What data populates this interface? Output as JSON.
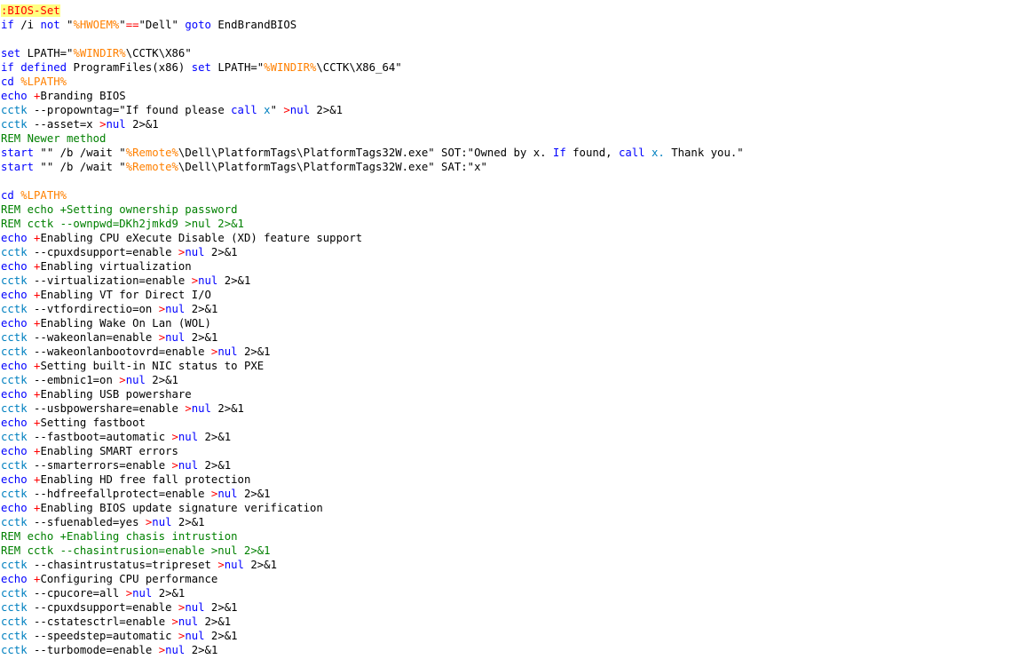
{
  "editor": {
    "language": "batch",
    "colors": {
      "keyword": "#0000ff",
      "string": "#808080",
      "variable": "#ff8000",
      "operator": "#ff0000",
      "label": "#ff0000",
      "label_highlight": "#ffff80",
      "comment": "#008000",
      "command": "#0080c0",
      "text": "#000000"
    },
    "lines": [
      [
        {
          "t": "label",
          "v": ":BIOS-Set"
        }
      ],
      [
        {
          "t": "kw",
          "v": "if"
        },
        {
          "t": "txt",
          "v": " /i "
        },
        {
          "t": "kw",
          "v": "not"
        },
        {
          "t": "txt",
          "v": " \""
        },
        {
          "t": "var",
          "v": "%HWOEM%"
        },
        {
          "t": "txt",
          "v": "\""
        },
        {
          "t": "op",
          "v": "=="
        },
        {
          "t": "txt",
          "v": "\"Dell\" "
        },
        {
          "t": "kw",
          "v": "goto"
        },
        {
          "t": "txt",
          "v": " EndBrandBIOS"
        }
      ],
      [],
      [
        {
          "t": "kw",
          "v": "set"
        },
        {
          "t": "txt",
          "v": " LPATH=\""
        },
        {
          "t": "var",
          "v": "%WINDIR%"
        },
        {
          "t": "txt",
          "v": "\\CCTK\\X86\""
        }
      ],
      [
        {
          "t": "kw",
          "v": "if defined"
        },
        {
          "t": "txt",
          "v": " ProgramFiles(x86) "
        },
        {
          "t": "kw",
          "v": "set"
        },
        {
          "t": "txt",
          "v": " LPATH=\""
        },
        {
          "t": "var",
          "v": "%WINDIR%"
        },
        {
          "t": "txt",
          "v": "\\CCTK\\X86_64\""
        }
      ],
      [
        {
          "t": "kw",
          "v": "cd"
        },
        {
          "t": "txt",
          "v": " "
        },
        {
          "t": "var",
          "v": "%LPATH%"
        }
      ],
      [
        {
          "t": "kw",
          "v": "echo"
        },
        {
          "t": "txt",
          "v": " "
        },
        {
          "t": "op",
          "v": "+"
        },
        {
          "t": "txt",
          "v": "Branding BIOS"
        }
      ],
      [
        {
          "t": "cmd",
          "v": "cctk"
        },
        {
          "t": "txt",
          "v": " --propowntag=\"If found please "
        },
        {
          "t": "kw",
          "v": "call"
        },
        {
          "t": "txt",
          "v": " "
        },
        {
          "t": "cmd",
          "v": "x"
        },
        {
          "t": "txt",
          "v": "\" "
        },
        {
          "t": "op",
          "v": ">"
        },
        {
          "t": "kw",
          "v": "nul"
        },
        {
          "t": "txt",
          "v": " 2>&1"
        }
      ],
      [
        {
          "t": "cmd",
          "v": "cctk"
        },
        {
          "t": "txt",
          "v": " --asset=x "
        },
        {
          "t": "op",
          "v": ">"
        },
        {
          "t": "kw",
          "v": "nul"
        },
        {
          "t": "txt",
          "v": " 2>&1"
        }
      ],
      [
        {
          "t": "cmt",
          "v": "REM Newer method"
        }
      ],
      [
        {
          "t": "kw",
          "v": "start"
        },
        {
          "t": "txt",
          "v": " \"\" /b /wait \""
        },
        {
          "t": "var",
          "v": "%Remote%"
        },
        {
          "t": "txt",
          "v": "\\Dell\\PlatformTags\\PlatformTags32W.exe\" SOT:\"Owned by x. "
        },
        {
          "t": "kw",
          "v": "If"
        },
        {
          "t": "txt",
          "v": " found, "
        },
        {
          "t": "kw",
          "v": "call"
        },
        {
          "t": "txt",
          "v": " "
        },
        {
          "t": "cmd",
          "v": "x."
        },
        {
          "t": "txt",
          "v": " Thank you.\""
        }
      ],
      [
        {
          "t": "kw",
          "v": "start"
        },
        {
          "t": "txt",
          "v": " \"\" /b /wait \""
        },
        {
          "t": "var",
          "v": "%Remote%"
        },
        {
          "t": "txt",
          "v": "\\Dell\\PlatformTags\\PlatformTags32W.exe\" SAT:\"x\""
        }
      ],
      [],
      [
        {
          "t": "kw",
          "v": "cd"
        },
        {
          "t": "txt",
          "v": " "
        },
        {
          "t": "var",
          "v": "%LPATH%"
        }
      ],
      [
        {
          "t": "cmt",
          "v": "REM echo +Setting ownership password"
        }
      ],
      [
        {
          "t": "cmt",
          "v": "REM cctk --ownpwd=DKh2jmkd9 >nul 2>&1"
        }
      ],
      [
        {
          "t": "kw",
          "v": "echo"
        },
        {
          "t": "txt",
          "v": " "
        },
        {
          "t": "op",
          "v": "+"
        },
        {
          "t": "txt",
          "v": "Enabling CPU eXecute Disable (XD) feature support"
        }
      ],
      [
        {
          "t": "cmd",
          "v": "cctk"
        },
        {
          "t": "txt",
          "v": " --cpuxdsupport=enable "
        },
        {
          "t": "op",
          "v": ">"
        },
        {
          "t": "kw",
          "v": "nul"
        },
        {
          "t": "txt",
          "v": " 2>&1"
        }
      ],
      [
        {
          "t": "kw",
          "v": "echo"
        },
        {
          "t": "txt",
          "v": " "
        },
        {
          "t": "op",
          "v": "+"
        },
        {
          "t": "txt",
          "v": "Enabling virtualization"
        }
      ],
      [
        {
          "t": "cmd",
          "v": "cctk"
        },
        {
          "t": "txt",
          "v": " --virtualization=enable "
        },
        {
          "t": "op",
          "v": ">"
        },
        {
          "t": "kw",
          "v": "nul"
        },
        {
          "t": "txt",
          "v": " 2>&1"
        }
      ],
      [
        {
          "t": "kw",
          "v": "echo"
        },
        {
          "t": "txt",
          "v": " "
        },
        {
          "t": "op",
          "v": "+"
        },
        {
          "t": "txt",
          "v": "Enabling VT for Direct I/O"
        }
      ],
      [
        {
          "t": "cmd",
          "v": "cctk"
        },
        {
          "t": "txt",
          "v": " --vtfordirectio=on "
        },
        {
          "t": "op",
          "v": ">"
        },
        {
          "t": "kw",
          "v": "nul"
        },
        {
          "t": "txt",
          "v": " 2>&1"
        }
      ],
      [
        {
          "t": "kw",
          "v": "echo"
        },
        {
          "t": "txt",
          "v": " "
        },
        {
          "t": "op",
          "v": "+"
        },
        {
          "t": "txt",
          "v": "Enabling Wake On Lan (WOL)"
        }
      ],
      [
        {
          "t": "cmd",
          "v": "cctk"
        },
        {
          "t": "txt",
          "v": " --wakeonlan=enable "
        },
        {
          "t": "op",
          "v": ">"
        },
        {
          "t": "kw",
          "v": "nul"
        },
        {
          "t": "txt",
          "v": " 2>&1"
        }
      ],
      [
        {
          "t": "cmd",
          "v": "cctk"
        },
        {
          "t": "txt",
          "v": " --wakeonlanbootovrd=enable "
        },
        {
          "t": "op",
          "v": ">"
        },
        {
          "t": "kw",
          "v": "nul"
        },
        {
          "t": "txt",
          "v": " 2>&1"
        }
      ],
      [
        {
          "t": "kw",
          "v": "echo"
        },
        {
          "t": "txt",
          "v": " "
        },
        {
          "t": "op",
          "v": "+"
        },
        {
          "t": "txt",
          "v": "Setting built-in NIC status to PXE"
        }
      ],
      [
        {
          "t": "cmd",
          "v": "cctk"
        },
        {
          "t": "txt",
          "v": " --embnic1=on "
        },
        {
          "t": "op",
          "v": ">"
        },
        {
          "t": "kw",
          "v": "nul"
        },
        {
          "t": "txt",
          "v": " 2>&1"
        }
      ],
      [
        {
          "t": "kw",
          "v": "echo"
        },
        {
          "t": "txt",
          "v": " "
        },
        {
          "t": "op",
          "v": "+"
        },
        {
          "t": "txt",
          "v": "Enabling USB powershare"
        }
      ],
      [
        {
          "t": "cmd",
          "v": "cctk"
        },
        {
          "t": "txt",
          "v": " --usbpowershare=enable "
        },
        {
          "t": "op",
          "v": ">"
        },
        {
          "t": "kw",
          "v": "nul"
        },
        {
          "t": "txt",
          "v": " 2>&1"
        }
      ],
      [
        {
          "t": "kw",
          "v": "echo"
        },
        {
          "t": "txt",
          "v": " "
        },
        {
          "t": "op",
          "v": "+"
        },
        {
          "t": "txt",
          "v": "Setting fastboot"
        }
      ],
      [
        {
          "t": "cmd",
          "v": "cctk"
        },
        {
          "t": "txt",
          "v": " --fastboot=automatic "
        },
        {
          "t": "op",
          "v": ">"
        },
        {
          "t": "kw",
          "v": "nul"
        },
        {
          "t": "txt",
          "v": " 2>&1"
        }
      ],
      [
        {
          "t": "kw",
          "v": "echo"
        },
        {
          "t": "txt",
          "v": " "
        },
        {
          "t": "op",
          "v": "+"
        },
        {
          "t": "txt",
          "v": "Enabling SMART errors"
        }
      ],
      [
        {
          "t": "cmd",
          "v": "cctk"
        },
        {
          "t": "txt",
          "v": " --smarterrors=enable "
        },
        {
          "t": "op",
          "v": ">"
        },
        {
          "t": "kw",
          "v": "nul"
        },
        {
          "t": "txt",
          "v": " 2>&1"
        }
      ],
      [
        {
          "t": "kw",
          "v": "echo"
        },
        {
          "t": "txt",
          "v": " "
        },
        {
          "t": "op",
          "v": "+"
        },
        {
          "t": "txt",
          "v": "Enabling HD free fall protection"
        }
      ],
      [
        {
          "t": "cmd",
          "v": "cctk"
        },
        {
          "t": "txt",
          "v": " --hdfreefallprotect=enable "
        },
        {
          "t": "op",
          "v": ">"
        },
        {
          "t": "kw",
          "v": "nul"
        },
        {
          "t": "txt",
          "v": " 2>&1"
        }
      ],
      [
        {
          "t": "kw",
          "v": "echo"
        },
        {
          "t": "txt",
          "v": " "
        },
        {
          "t": "op",
          "v": "+"
        },
        {
          "t": "txt",
          "v": "Enabling BIOS update signature verification"
        }
      ],
      [
        {
          "t": "cmd",
          "v": "cctk"
        },
        {
          "t": "txt",
          "v": " --sfuenabled=yes "
        },
        {
          "t": "op",
          "v": ">"
        },
        {
          "t": "kw",
          "v": "nul"
        },
        {
          "t": "txt",
          "v": " 2>&1"
        }
      ],
      [
        {
          "t": "cmt",
          "v": "REM echo +Enabling chasis intrustion"
        }
      ],
      [
        {
          "t": "cmt",
          "v": "REM cctk --chasintrusion=enable >nul 2>&1"
        }
      ],
      [
        {
          "t": "cmd",
          "v": "cctk"
        },
        {
          "t": "txt",
          "v": " --chasintrustatus=tripreset "
        },
        {
          "t": "op",
          "v": ">"
        },
        {
          "t": "kw",
          "v": "nul"
        },
        {
          "t": "txt",
          "v": " 2>&1"
        }
      ],
      [
        {
          "t": "kw",
          "v": "echo"
        },
        {
          "t": "txt",
          "v": " "
        },
        {
          "t": "op",
          "v": "+"
        },
        {
          "t": "txt",
          "v": "Configuring CPU performance"
        }
      ],
      [
        {
          "t": "cmd",
          "v": "cctk"
        },
        {
          "t": "txt",
          "v": " --cpucore=all "
        },
        {
          "t": "op",
          "v": ">"
        },
        {
          "t": "kw",
          "v": "nul"
        },
        {
          "t": "txt",
          "v": " 2>&1"
        }
      ],
      [
        {
          "t": "cmd",
          "v": "cctk"
        },
        {
          "t": "txt",
          "v": " --cpuxdsupport=enable "
        },
        {
          "t": "op",
          "v": ">"
        },
        {
          "t": "kw",
          "v": "nul"
        },
        {
          "t": "txt",
          "v": " 2>&1"
        }
      ],
      [
        {
          "t": "cmd",
          "v": "cctk"
        },
        {
          "t": "txt",
          "v": " --cstatesctrl=enable "
        },
        {
          "t": "op",
          "v": ">"
        },
        {
          "t": "kw",
          "v": "nul"
        },
        {
          "t": "txt",
          "v": " 2>&1"
        }
      ],
      [
        {
          "t": "cmd",
          "v": "cctk"
        },
        {
          "t": "txt",
          "v": " --speedstep=automatic "
        },
        {
          "t": "op",
          "v": ">"
        },
        {
          "t": "kw",
          "v": "nul"
        },
        {
          "t": "txt",
          "v": " 2>&1"
        }
      ],
      [
        {
          "t": "cmd",
          "v": "cctk"
        },
        {
          "t": "txt",
          "v": " --turbomode=enable "
        },
        {
          "t": "op",
          "v": ">"
        },
        {
          "t": "kw",
          "v": "nul"
        },
        {
          "t": "txt",
          "v": " 2>&1"
        }
      ]
    ]
  }
}
